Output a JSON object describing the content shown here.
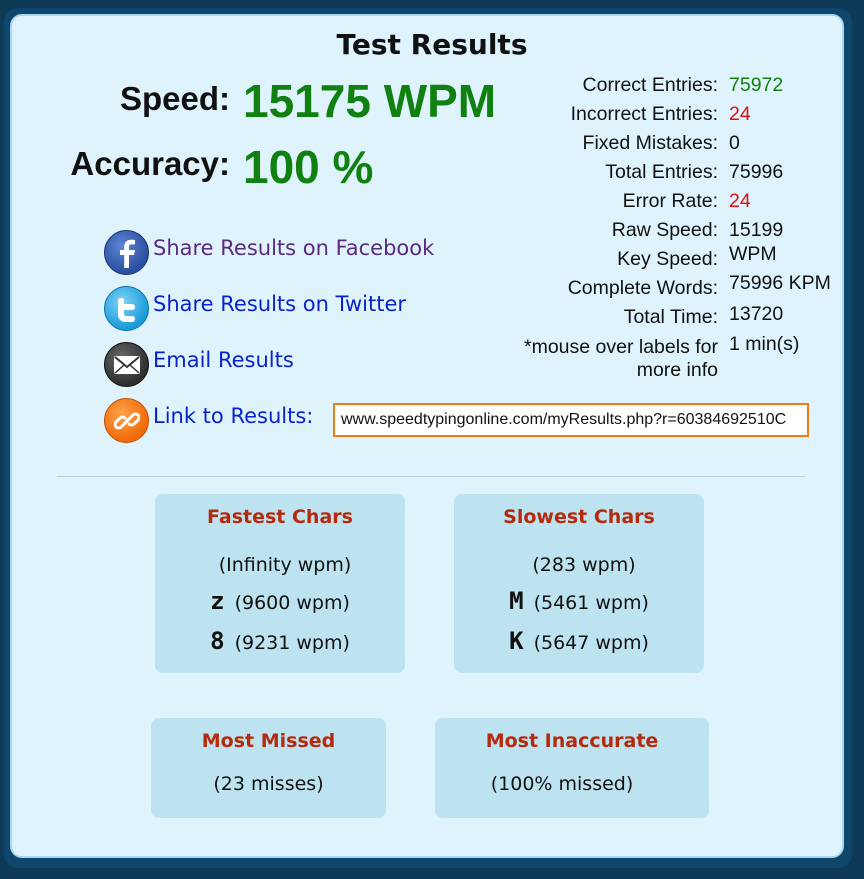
{
  "title": "Test Results",
  "speed": {
    "label": "Speed:",
    "value": "15175 WPM"
  },
  "accuracy": {
    "label": "Accuracy:",
    "value": "100 %"
  },
  "stats": [
    {
      "label": "Correct Entries:",
      "value": "75972",
      "color": "green"
    },
    {
      "label": "Incorrect Entries:",
      "value": "24",
      "color": "red"
    },
    {
      "label": "Fixed Mistakes:",
      "value": "0",
      "color": "black"
    },
    {
      "label": "Total Entries:",
      "value": "75996",
      "color": "black"
    },
    {
      "label": "Error Rate:",
      "value": "24",
      "color": "red"
    },
    {
      "label": "Raw Speed:",
      "value": "15199",
      "color": "black"
    },
    {
      "label": "Key Speed:",
      "value": "WPM",
      "color": "black"
    },
    {
      "label": "Complete Words:",
      "value": "75996 KPM",
      "color": "black"
    },
    {
      "label": "Total Time:",
      "value": "13720",
      "color": "black"
    },
    {
      "label": "*mouse over labels for more info",
      "value": "1 min(s)",
      "color": "black"
    }
  ],
  "share": {
    "facebook": "Share Results on Facebook",
    "twitter": "Share Results on Twitter",
    "email": "Email Results",
    "link": "Link to Results:",
    "url": "www.speedtypingonline.com/myResults.php?r=60384692510C"
  },
  "fastest": {
    "title": "Fastest Chars",
    "rows": [
      {
        "char": "",
        "wpm": "(Infinity wpm)"
      },
      {
        "char": "z",
        "wpm": "(9600 wpm)"
      },
      {
        "char": "8",
        "wpm": "(9231 wpm)"
      }
    ]
  },
  "slowest": {
    "title": "Slowest Chars",
    "rows": [
      {
        "char": "",
        "wpm": "(283 wpm)"
      },
      {
        "char": "M",
        "wpm": "(5461 wpm)"
      },
      {
        "char": "K",
        "wpm": "(5647 wpm)"
      }
    ]
  },
  "most_missed": {
    "title": "Most Missed",
    "text": "(23 misses)"
  },
  "most_inaccurate": {
    "title": "Most Inaccurate",
    "text": "(100% missed)"
  },
  "colors": {
    "green": "#108010",
    "red": "#e01010",
    "accent": "#b52a0c",
    "link": "#0a22cc",
    "visited": "#5a2a80"
  }
}
